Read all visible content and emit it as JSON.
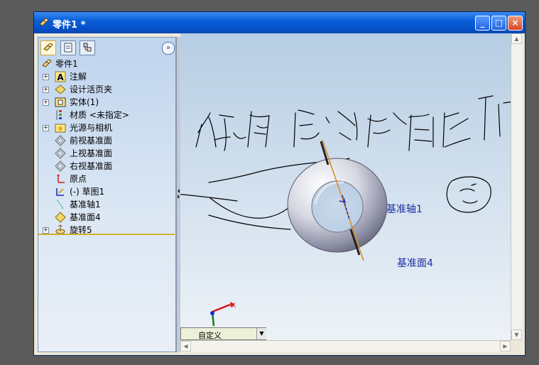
{
  "window": {
    "title": "零件1 *",
    "buttons": {
      "minimize": "_",
      "maximize": "□",
      "close": "×"
    }
  },
  "panel": {
    "tabs": [
      {
        "name": "featuremanager",
        "icon": "part-icon"
      },
      {
        "name": "propertymanager",
        "icon": "property-sheet-icon"
      },
      {
        "name": "configurationmanager",
        "icon": "configuration-icon"
      }
    ],
    "expand_glyph": "»",
    "tree": {
      "root": {
        "label": "零件1",
        "icon": "part-icon"
      },
      "items": [
        {
          "label": "注解",
          "icon": "annotation-icon",
          "expandable": true
        },
        {
          "label": "设计活页夹",
          "icon": "design-binder-icon",
          "expandable": true
        },
        {
          "label": "实体(1)",
          "icon": "solid-bodies-icon",
          "expandable": true
        },
        {
          "label": "材质 <未指定>",
          "icon": "material-icon",
          "expandable": false
        },
        {
          "label": "光源与相机",
          "icon": "lights-cameras-icon",
          "expandable": true
        },
        {
          "label": "前视基准面",
          "icon": "plane-icon",
          "expandable": false
        },
        {
          "label": "上视基准面",
          "icon": "plane-icon",
          "expandable": false
        },
        {
          "label": "右视基准面",
          "icon": "plane-icon",
          "expandable": false
        },
        {
          "label": "原点",
          "icon": "origin-icon",
          "expandable": false
        },
        {
          "label": "(-) 草图1",
          "icon": "sketch-icon",
          "expandable": false
        },
        {
          "label": "基准轴1",
          "icon": "axis-icon",
          "expandable": false
        },
        {
          "label": "基准面4",
          "icon": "plane-icon",
          "expandable": false
        },
        {
          "label": "旋转5",
          "icon": "revolve-icon",
          "expandable": true
        }
      ]
    }
  },
  "viewport": {
    "axis_label": "基准轴1",
    "plane_label": "基准面4",
    "triad": {
      "x": "X",
      "y": "Y"
    },
    "view_orientation": "自定义",
    "handwriting_visible": true
  },
  "colors": {
    "titlebar": "#0a5fd8",
    "label_blue": "#1e2fa6",
    "plane_orange": "#d98a1e",
    "feature_tree_separator": "#d1b32a"
  }
}
